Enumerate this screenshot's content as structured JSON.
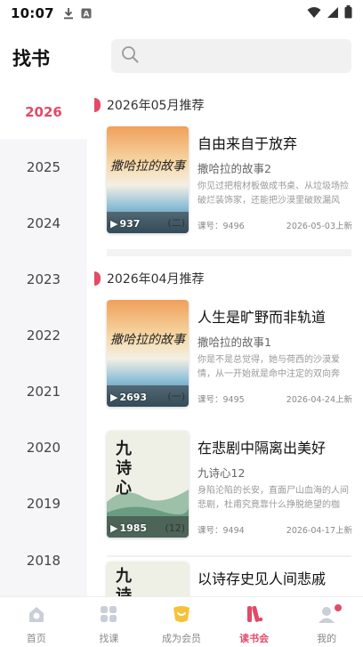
{
  "status_bar": {
    "time": "10:07",
    "icons": [
      "download-icon",
      "a-icon",
      "wifi-icon",
      "signal-icon",
      "battery-icon"
    ]
  },
  "header": {
    "title": "找书",
    "search_placeholder": ""
  },
  "years": [
    {
      "label": "2026",
      "active": true
    },
    {
      "label": "2025",
      "active": false
    },
    {
      "label": "2024",
      "active": false
    },
    {
      "label": "2023",
      "active": false
    },
    {
      "label": "2022",
      "active": false
    },
    {
      "label": "2021",
      "active": false
    },
    {
      "label": "2020",
      "active": false
    },
    {
      "label": "2019",
      "active": false
    },
    {
      "label": "2018",
      "active": false
    }
  ],
  "sections": [
    {
      "month_title": "2026年05月推荐",
      "books": [
        {
          "title": "自由来自于放弃",
          "subtitle": "撒哈拉的故事2",
          "description": "你见过把棺材板做成书桌、从垃圾场捡破烂装饰家，还能把沙漠里破败漏风的…",
          "lesson": "课号：9496",
          "date": "2026-05-03上新",
          "plays": "937",
          "volume": "(二)",
          "cover_text": "撒哈拉的故事",
          "cover_style": "sahara"
        }
      ]
    },
    {
      "month_title": "2026年04月推荐",
      "books": [
        {
          "title": "人生是旷野而非轨道",
          "subtitle": "撒哈拉的故事1",
          "description": "你是不是总觉得，她与荷西的沙漠爱情，从一开始就是命中注定的双向奔赴…",
          "lesson": "课号：9495",
          "date": "2026-04-24上新",
          "plays": "2693",
          "volume": "(一)",
          "cover_text": "撒哈拉的故事",
          "cover_style": "sahara"
        },
        {
          "title": "在悲剧中隔离出美好",
          "subtitle": "九诗心12",
          "description": "身陷沦陷的长安，直面尸山血海的人间悲剧，杜甫究竟靠什么挣脱绝望的枷锁…",
          "lesson": "课号：9494",
          "date": "2026-04-17上新",
          "plays": "1985",
          "volume": "(12)",
          "cover_text": "九诗心",
          "cover_style": "poem"
        },
        {
          "title": "以诗存史见人间悲戚",
          "subtitle": "",
          "description": "",
          "lesson": "",
          "date": "",
          "plays": "",
          "volume": "",
          "cover_text": "九诗",
          "cover_style": "poem"
        }
      ]
    }
  ],
  "bottom_nav": [
    {
      "label": "首页",
      "icon": "home-icon",
      "active": false
    },
    {
      "label": "找课",
      "icon": "grid-icon",
      "active": false
    },
    {
      "label": "成为会员",
      "icon": "vip-icon",
      "active": false
    },
    {
      "label": "读书会",
      "icon": "book-club-icon",
      "active": true
    },
    {
      "label": "我的",
      "icon": "profile-icon",
      "active": false,
      "badge": true
    }
  ],
  "colors": {
    "accent": "#e24b67",
    "sidebar_bg": "#f6f6f8"
  }
}
